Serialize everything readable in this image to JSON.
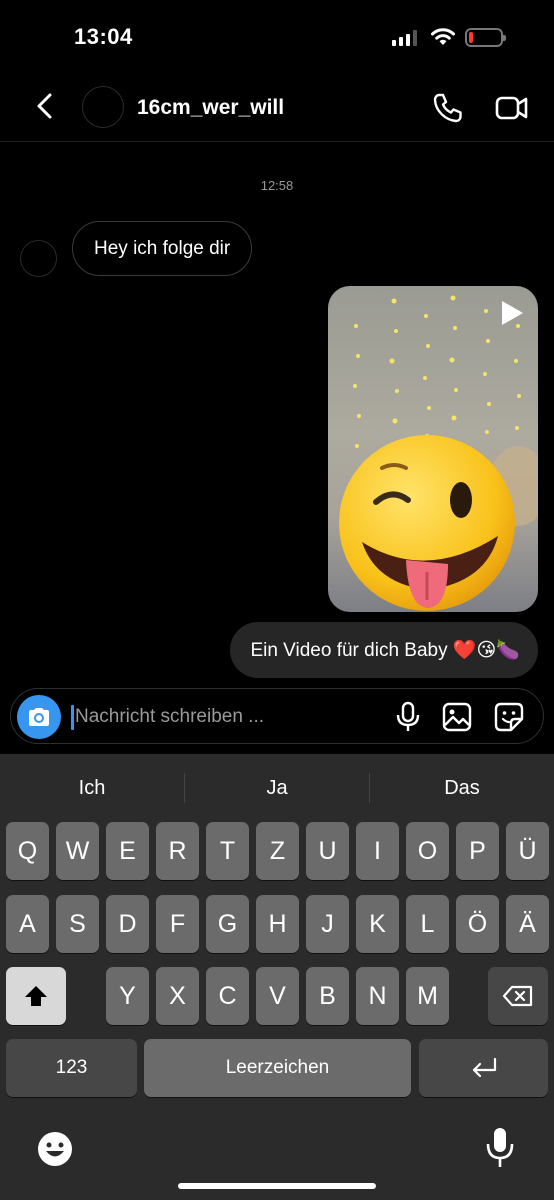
{
  "status_bar": {
    "time": "13:04"
  },
  "header": {
    "username": "16cm_wer_will"
  },
  "chat": {
    "timestamp": "12:58",
    "incoming_message": "Hey ich folge dir",
    "outgoing_message": "Ein Video für dich Baby ❤️😘🍆"
  },
  "composer": {
    "placeholder": "Nachricht schreiben ..."
  },
  "keyboard": {
    "suggestions": [
      "Ich",
      "Ja",
      "Das"
    ],
    "row1": [
      "Q",
      "W",
      "E",
      "R",
      "T",
      "Z",
      "U",
      "I",
      "O",
      "P",
      "Ü"
    ],
    "row2": [
      "A",
      "S",
      "D",
      "F",
      "G",
      "H",
      "J",
      "K",
      "L",
      "Ö",
      "Ä"
    ],
    "row3": [
      "Y",
      "X",
      "C",
      "V",
      "B",
      "N",
      "M"
    ],
    "numbers_label": "123",
    "space_label": "Leerzeichen"
  },
  "colors": {
    "accent": "#3797f0",
    "battery_low": "#ff3b30",
    "bubble_out": "#262626",
    "keyboard_bg": "#2b2b2b"
  }
}
